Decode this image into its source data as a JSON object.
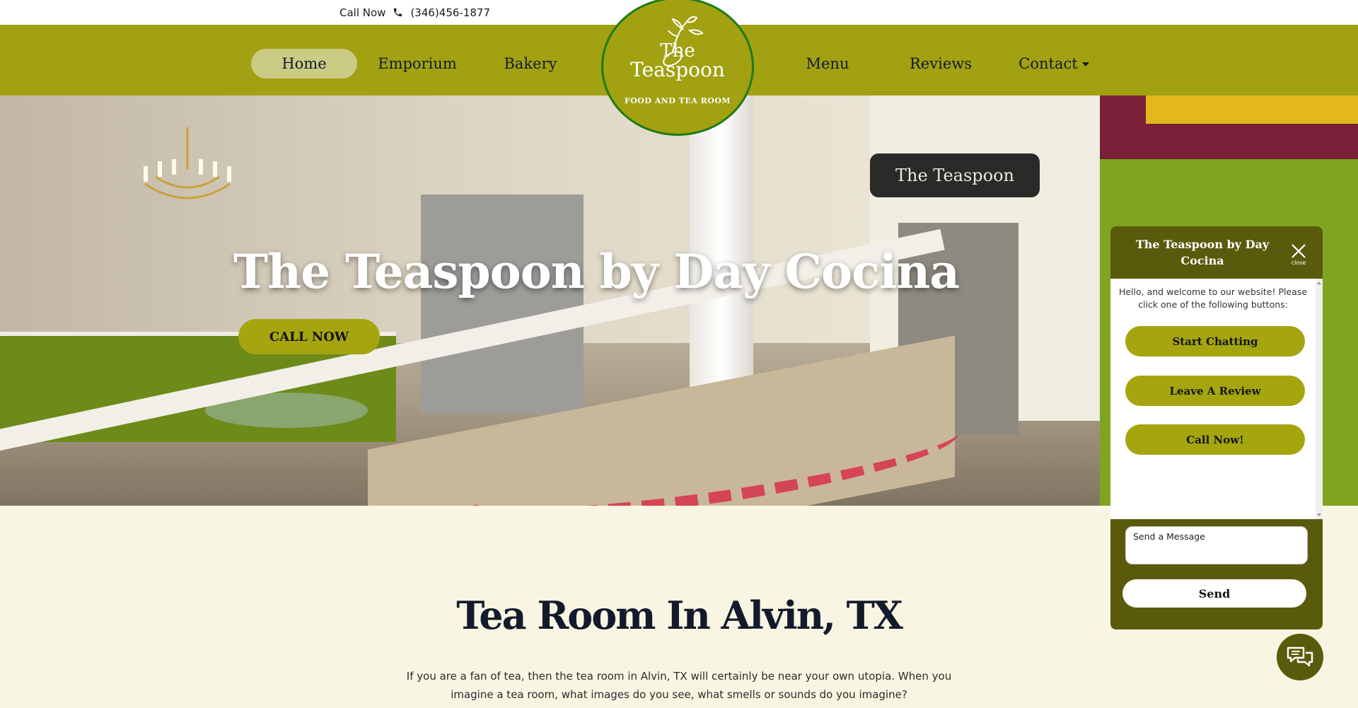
{
  "topbar": {
    "call_label": "Call Now",
    "phone": "(346)456-1877",
    "icon": "phone-icon"
  },
  "nav": {
    "items": [
      {
        "label": "Home",
        "active": true
      },
      {
        "label": "Emporium"
      },
      {
        "label": "Bakery"
      },
      {
        "label": "Menu"
      },
      {
        "label": "Reviews"
      },
      {
        "label": "Contact",
        "has_dropdown": true
      }
    ]
  },
  "logo": {
    "line1": "The",
    "line2": "Teaspoon",
    "tagline": "FOOD AND TEA ROOM"
  },
  "hero": {
    "title": "The Teaspoon by Day Cocina",
    "cta": "CALL NOW",
    "sign_text": "The Teaspoon"
  },
  "section": {
    "title": "Tea Room In Alvin, TX",
    "body": "If you are a fan of tea, then the tea room in Alvin, TX will certainly be near your own utopia. When you imagine a tea room, what images do you see, what smells or sounds do you imagine?"
  },
  "chat": {
    "title": "The Teaspoon by Day Cocina",
    "close_label": "close",
    "welcome": "Hello, and welcome to our website! Please click one of the following buttons:",
    "buttons": [
      "Start Chatting",
      "Leave A Review",
      "Call Now!"
    ],
    "input_placeholder": "Send a Message",
    "send_label": "Send"
  },
  "colors": {
    "brand_olive": "#a1a112",
    "chat_dark": "#5a5a0d",
    "active_pill": "#cbcc84",
    "page_bg": "#f8f6e2",
    "heading": "#131a2c"
  }
}
